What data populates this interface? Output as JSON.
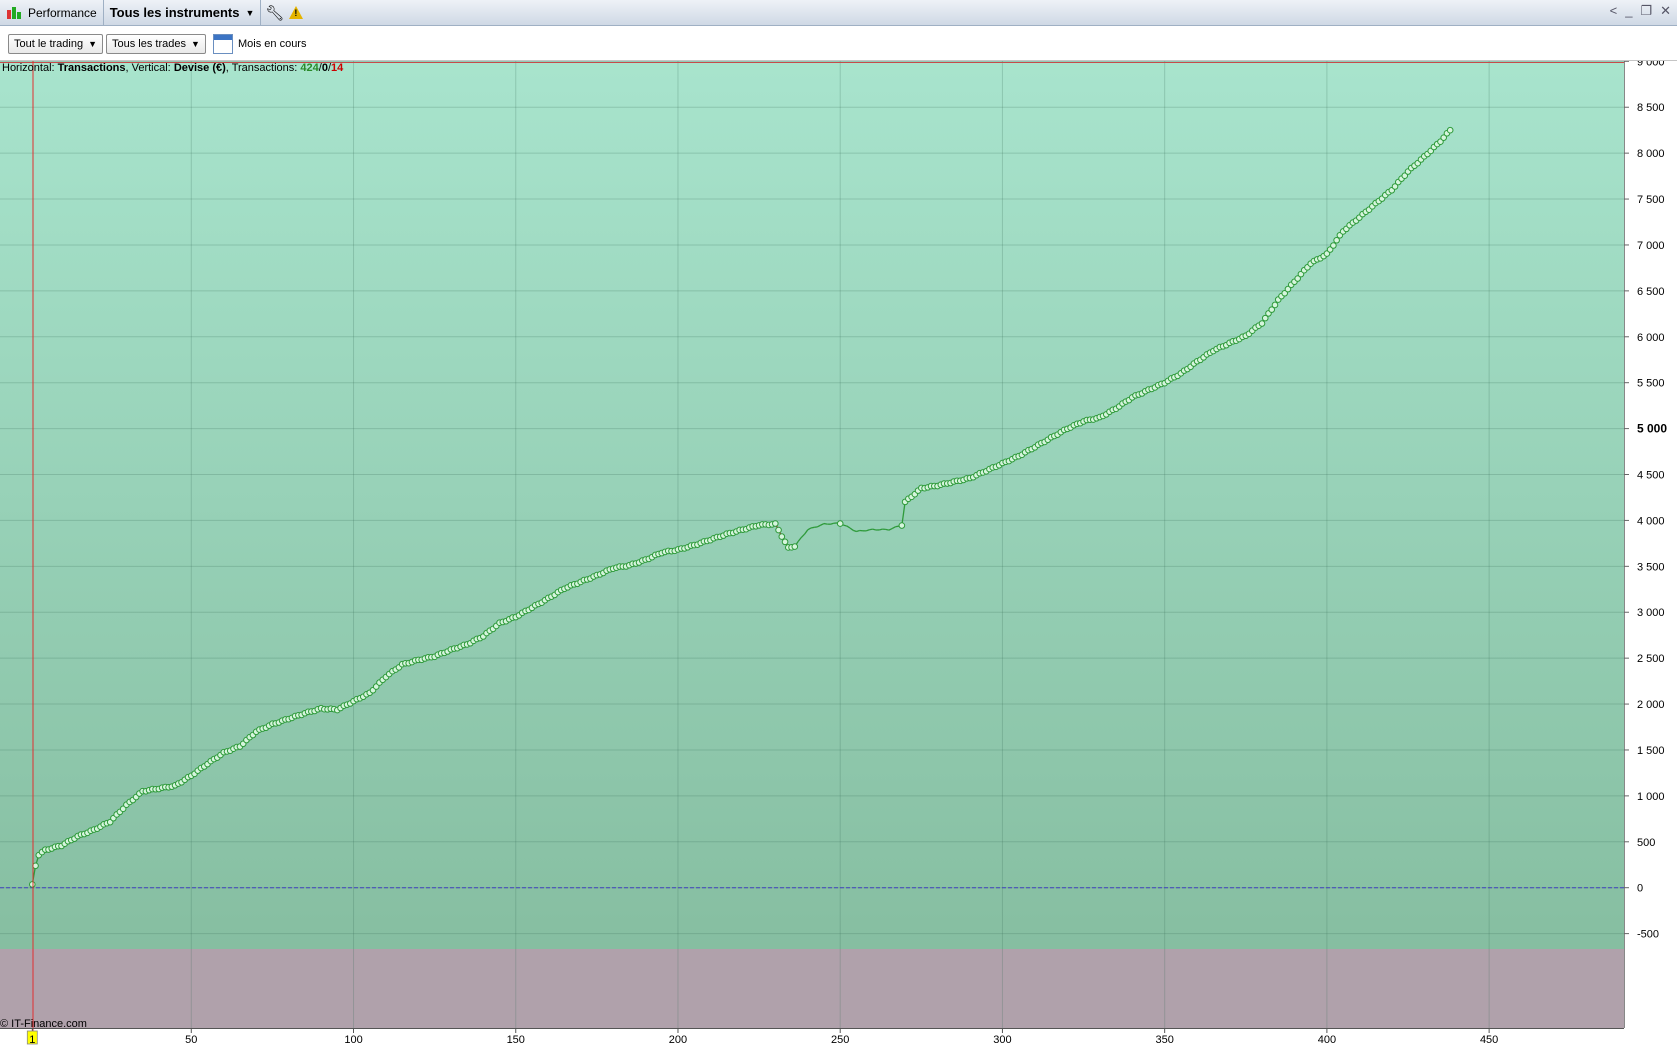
{
  "titlebar": {
    "app_title": "Performance",
    "instrument_selector": "Tous les instruments",
    "icons": [
      "candlestick-icon",
      "wrench-icon",
      "warning-icon",
      "share-icon",
      "minimize-icon",
      "restore-icon",
      "close-icon"
    ]
  },
  "toolbar": {
    "trading_filter": "Tout le trading",
    "trade_filter": "Tous les trades",
    "period_label": "Mois en cours"
  },
  "info": {
    "horizontal_prefix": "Horizontal:",
    "horizontal_value": "Transactions",
    "vertical_prefix": ", Vertical:",
    "vertical_value": "Devise (€)",
    "transactions_prefix": ", Transactions:",
    "wins": "424",
    "sep1": "/",
    "neutral": "0",
    "sep2": "/",
    "losses": "14"
  },
  "copyright": "© IT-Finance.com",
  "colors": {
    "positive_zone_top": "#a8e4cd",
    "positive_zone_bottom": "#86bea1",
    "negative_zone": "#b0a1ab",
    "equity_line": "#2e9a3a",
    "loss_segment": "#b02020",
    "marker_fill": "#d6f5dd",
    "cursor_line": "#e03030",
    "zero_line": "#4040c0"
  },
  "chart_data": {
    "type": "line",
    "title": "",
    "xlabel": "",
    "ylabel": "",
    "xlim": [
      0,
      460
    ],
    "ylim": [
      -820,
      9050
    ],
    "xticks": [
      "1",
      "50",
      "100",
      "150",
      "200",
      "250",
      "300",
      "350",
      "400",
      "450"
    ],
    "xtick_values": [
      1,
      50,
      100,
      150,
      200,
      250,
      300,
      350,
      400,
      450
    ],
    "yticks": [
      "9 000",
      "8 500",
      "8 000",
      "7 500",
      "7 000",
      "6 500",
      "6 000",
      "5 500",
      "5 000",
      "4 500",
      "4 000",
      "3 500",
      "3 000",
      "2 500",
      "2 000",
      "1 500",
      "1 000",
      "500",
      "0",
      "-500"
    ],
    "ytick_values": [
      9000,
      8500,
      8000,
      7500,
      7000,
      6500,
      6000,
      5500,
      5000,
      4500,
      4000,
      3500,
      3000,
      2500,
      2000,
      1500,
      1000,
      500,
      0,
      -500
    ],
    "grid": true,
    "series": [
      {
        "anchors_x": [
          1,
          2,
          3,
          5,
          10,
          15,
          20,
          25,
          30,
          35,
          40,
          45,
          50,
          55,
          60,
          65,
          70,
          75,
          80,
          85,
          90,
          95,
          100,
          105,
          110,
          115,
          120,
          125,
          130,
          135,
          140,
          145,
          150,
          155,
          160,
          165,
          170,
          175,
          180,
          185,
          190,
          195,
          200,
          205,
          210,
          215,
          220,
          225,
          230,
          234,
          236,
          240,
          245,
          250,
          255,
          260,
          265,
          269,
          270,
          275,
          280,
          285,
          290,
          295,
          300,
          305,
          310,
          315,
          320,
          325,
          330,
          335,
          340,
          345,
          350,
          355,
          360,
          365,
          370,
          375,
          380,
          385,
          390,
          395,
          400,
          405,
          410,
          415,
          420,
          425,
          430,
          435,
          438
        ],
        "anchors_y": [
          30,
          240,
          360,
          410,
          460,
          560,
          630,
          720,
          900,
          1050,
          1080,
          1110,
          1220,
          1350,
          1470,
          1540,
          1700,
          1780,
          1840,
          1900,
          1950,
          1940,
          2030,
          2120,
          2300,
          2430,
          2480,
          2520,
          2590,
          2650,
          2740,
          2880,
          2950,
          3050,
          3150,
          3260,
          3330,
          3400,
          3480,
          3510,
          3570,
          3650,
          3680,
          3730,
          3790,
          3850,
          3900,
          3950,
          3960,
          3700,
          3720,
          3900,
          3960,
          3970,
          3880,
          3900,
          3900,
          3950,
          4200,
          4350,
          4380,
          4420,
          4460,
          4540,
          4620,
          4700,
          4800,
          4900,
          5000,
          5080,
          5120,
          5220,
          5340,
          5420,
          5500,
          5600,
          5730,
          5850,
          5930,
          6010,
          6150,
          6400,
          6600,
          6800,
          6900,
          7150,
          7300,
          7450,
          7600,
          7800,
          7960,
          8130,
          8250
        ],
        "markers": "all trades marked with circles except x 237–268 (drawdown section)"
      }
    ]
  }
}
